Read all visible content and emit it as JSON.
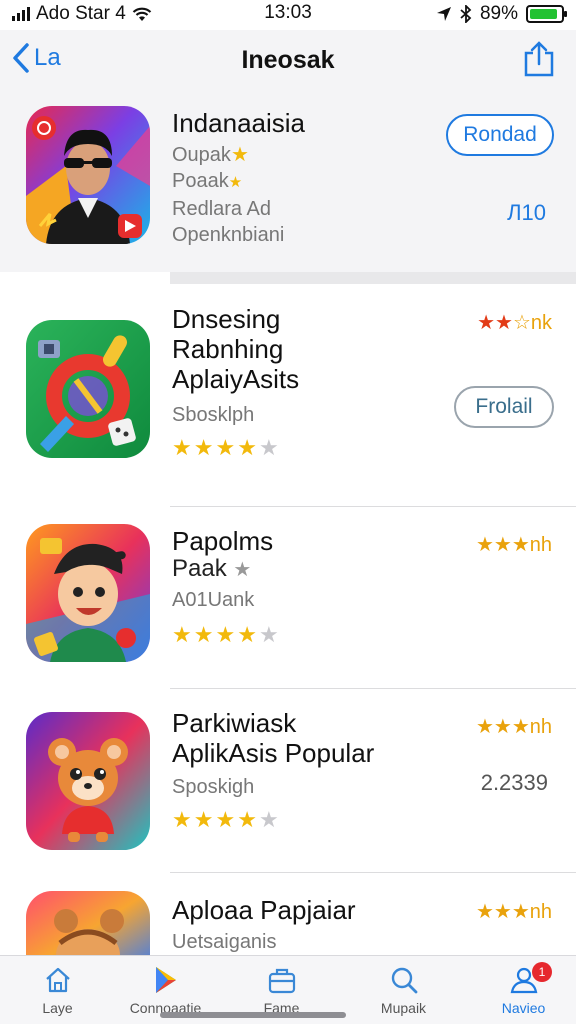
{
  "status_bar": {
    "carrier": "Ado Star 4",
    "time": "13:03",
    "battery": "89%",
    "battery_level": 0.89
  },
  "nav": {
    "back_label": "La",
    "title": "Ineosak"
  },
  "apps": [
    {
      "name": "Indanaaisia",
      "line2": "Oupak",
      "line3": "Poaak",
      "line4": "Redlara Ad",
      "line5": "Openknbiani",
      "button": "Rondad",
      "price": "Л10"
    },
    {
      "name_lines": [
        "Dnsesing",
        "Rabnhing",
        "AplaiyAsits"
      ],
      "sub": "Sbosklph",
      "rating_text": "nk",
      "stars": 4,
      "button": "Frolail"
    },
    {
      "name": "Papolms",
      "line2": "Paak",
      "sub": "A01Uank",
      "rating_text": "nh",
      "stars": 4
    },
    {
      "name": "Parkiwiask",
      "line2": "AplikAsis Popular",
      "sub": "Sposkigh",
      "rating_text": "nh",
      "stars": 4,
      "price": "2.2339"
    },
    {
      "name": "Aploaa Papjaiar",
      "sub": "Uetsaiganis",
      "rating_text": "nh"
    }
  ],
  "tabs": [
    {
      "label": "Laye",
      "icon": "home-icon"
    },
    {
      "label": "Connoaatie",
      "icon": "play-store-icon"
    },
    {
      "label": "Fame",
      "icon": "briefcase-icon"
    },
    {
      "label": "Mupaik",
      "icon": "search-icon"
    },
    {
      "label": "Navieo",
      "icon": "profile-icon",
      "badge": "1"
    }
  ],
  "colors": {
    "accent": "#1f7ae0",
    "star": "#f2b90c",
    "badge": "#e6282e"
  }
}
